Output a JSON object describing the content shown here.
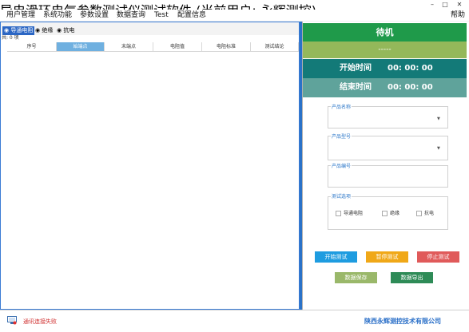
{
  "window": {
    "title": "导电滑环电气参数测试仪测试软件 (当前用户: 永辉测控)",
    "minimize": "–",
    "maximize": "□",
    "close": "✕"
  },
  "menu": {
    "items": [
      "用户管理",
      "系统功能",
      "参数设置",
      "数据查询",
      "Test",
      "配置信息"
    ],
    "help": "帮助"
  },
  "tabs": [
    "导通电阻",
    "绝缘",
    "抗电"
  ],
  "record_count": "共: 0 项",
  "grid": {
    "columns": [
      "序号",
      "始端点",
      "末端点",
      "电阻值",
      "电阻标准",
      "测试结论"
    ]
  },
  "status": {
    "state": "待机",
    "sub": "-----",
    "start_label": "开始时间",
    "start_value": "00: 00: 00",
    "end_label": "结束时间",
    "end_value": "00: 00: 00"
  },
  "form": {
    "product_name_label": "产品名称",
    "product_model_label": "产品型号",
    "product_no_label": "产品编号",
    "test_options_label": "测试选项",
    "options": [
      "导通电阻",
      "绝缘",
      "抗电"
    ]
  },
  "buttons": {
    "start": "开始测试",
    "pause": "暂停测试",
    "stop": "停止测试",
    "save": "数据保存",
    "export": "数据导出"
  },
  "colors": {
    "start_btn": "#1e9ce0",
    "pause_btn": "#f0a818",
    "stop_btn": "#e05a5a",
    "save_btn": "#9ab86a",
    "export_btn": "#2e8b57"
  },
  "footer": {
    "connection_status": "通讯连接失败",
    "company": "陕西永辉测控技术有限公司"
  }
}
